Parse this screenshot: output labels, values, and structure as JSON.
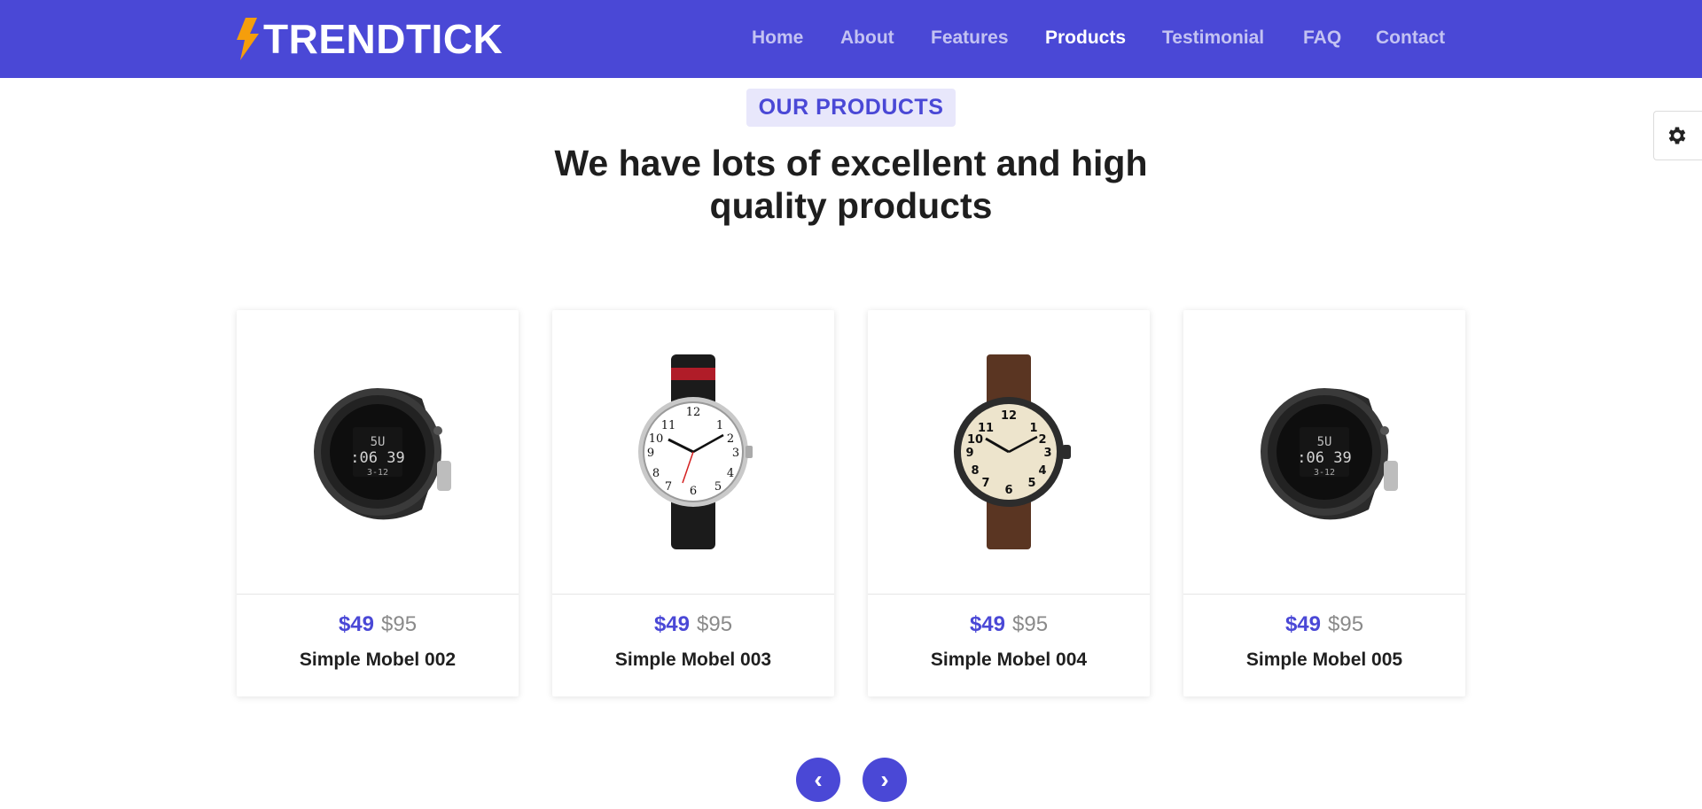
{
  "brand": {
    "name": "TRENDTICK",
    "accent": "#f59e0b",
    "color": "#4a48d6"
  },
  "nav": {
    "items": [
      {
        "label": "Home",
        "active": false
      },
      {
        "label": "About",
        "active": false
      },
      {
        "label": "Features",
        "active": false
      },
      {
        "label": "Products",
        "active": true
      },
      {
        "label": "Testimonial",
        "active": false
      },
      {
        "label": "FAQ",
        "active": false
      },
      {
        "label": "Contact",
        "active": false
      }
    ]
  },
  "section": {
    "badge": "OUR PRODUCTS",
    "headline_line1": "We have lots of excellent and high",
    "headline_line2": "quality products"
  },
  "products": [
    {
      "price": "$49",
      "old_price": "$95",
      "name": "Simple Mobel 002",
      "image": "digital-sport-watch"
    },
    {
      "price": "$49",
      "old_price": "$95",
      "name": "Simple Mobel 003",
      "image": "white-dial-leather-watch"
    },
    {
      "price": "$49",
      "old_price": "$95",
      "name": "Simple Mobel 004",
      "image": "field-watch-brown-strap"
    },
    {
      "price": "$49",
      "old_price": "$95",
      "name": "Simple Mobel 005",
      "image": "digital-sport-watch"
    }
  ],
  "carousel": {
    "prev_icon": "‹",
    "next_icon": "›"
  },
  "settings": {
    "icon": "gear-icon"
  }
}
